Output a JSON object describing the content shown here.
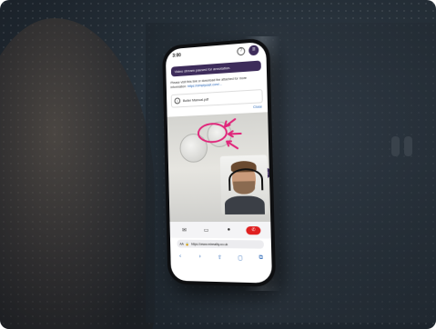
{
  "phone": {
    "status_time": "3:00",
    "toast": "Video stream paused for annotation.",
    "info_text": "Please visit this link or download the attached for more information:",
    "info_link": "https://simplycast.com/...",
    "attachment_name": "Boiler Manual.pdf",
    "close_label": "Close",
    "avatar_initials": "FC",
    "url": "https://www.mireality.co.uk",
    "lang": "AA"
  },
  "colors": {
    "brand_purple": "#3d2c5a",
    "annotation_pink": "#e0257a",
    "end_call_red": "#e02020",
    "link_blue": "#1e5fb3"
  }
}
